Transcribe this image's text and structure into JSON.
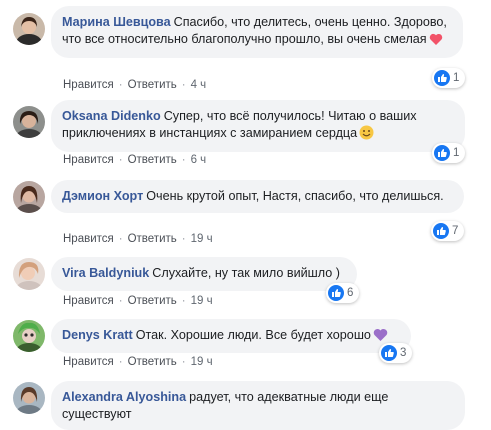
{
  "comments": [
    {
      "author": "Марина Шевцова",
      "text": "Спасибо, что делитесь, очень ценно. Здорово, что все относительно благополучно прошло, вы очень смелая",
      "emoji": "heart-emoji",
      "actions": {
        "like": "Нравится",
        "reply": "Ответить",
        "time": "4 ч"
      },
      "reaction_count": "1"
    },
    {
      "author": "Oksana Didenko",
      "text": "Супер, что всё получилось! Читаю о ваших приключениях в инстанциях с замиранием сердца",
      "emoji": "smile-emoji",
      "actions": {
        "like": "Нравится",
        "reply": "Ответить",
        "time": "6 ч"
      },
      "reaction_count": "1"
    },
    {
      "author": "Дэмион Хорт",
      "text": "Очень крутой опыт, Настя, спасибо, что делишься.",
      "actions": {
        "like": "Нравится",
        "reply": "Ответить",
        "time": "19 ч"
      },
      "reaction_count": "7"
    },
    {
      "author": "Vira Baldyniuk",
      "text": "Слухайте, ну так мило вийшло )",
      "actions": {
        "like": "Нравится",
        "reply": "Ответить",
        "time": "19 ч"
      },
      "reaction_count": "6"
    },
    {
      "author": "Denys Kratt",
      "text": "Отак. Хорошие люди. Все будет хорошо",
      "emoji": "purple-heart-emoji",
      "actions": {
        "like": "Нравится",
        "reply": "Ответить",
        "time": "19 ч"
      },
      "reaction_count": "3"
    },
    {
      "author": "Alexandra Alyoshina",
      "text": "радует, что адекватные люди еще существуют"
    }
  ],
  "colors": {
    "author": "#385898",
    "bubble": "#f2f3f5",
    "like_blue": "#1877f2"
  }
}
